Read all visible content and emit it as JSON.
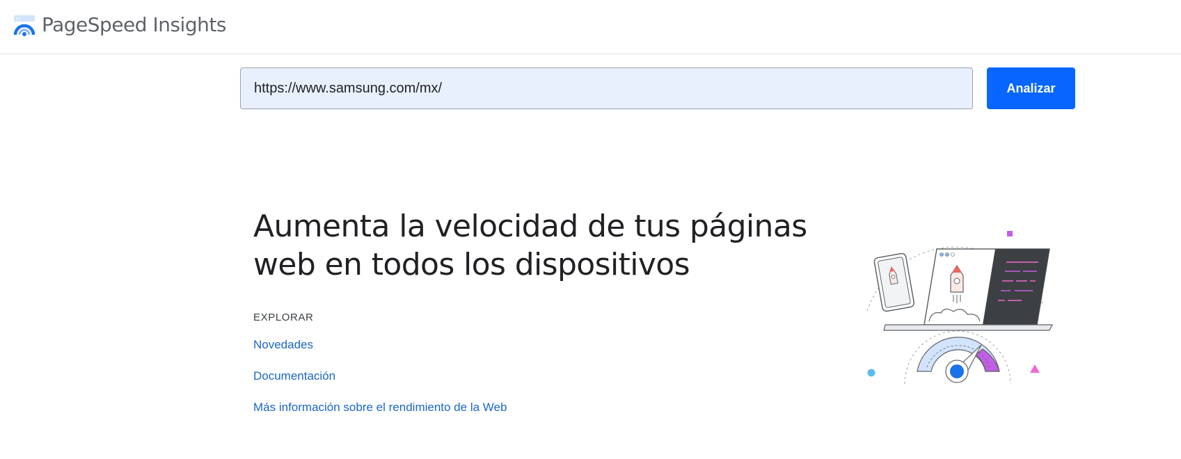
{
  "header": {
    "app_title": "PageSpeed Insights",
    "logo_icon": "pagespeed-gauge-logo"
  },
  "search": {
    "value": "https://www.samsung.com/mx/",
    "button_label": "Analizar",
    "button_color": "#0866ff",
    "input_background": "#e8f0fe"
  },
  "hero": {
    "headline": "Aumenta la velocidad de tus páginas web en todos los dispositivos",
    "explore_label": "EXPLORAR",
    "links": [
      {
        "label": "Novedades"
      },
      {
        "label": "Documentación"
      },
      {
        "label": "Más información sobre el rendimiento de la Web"
      }
    ],
    "illustration_icon": "devices-speed-gauge-illustration"
  },
  "colors": {
    "link": "#1a66c9",
    "accent_purple": "#c35ee6",
    "accent_pink": "#f06acd",
    "accent_blue": "#1a73e8",
    "accent_light_blue": "#5bbcf2"
  }
}
